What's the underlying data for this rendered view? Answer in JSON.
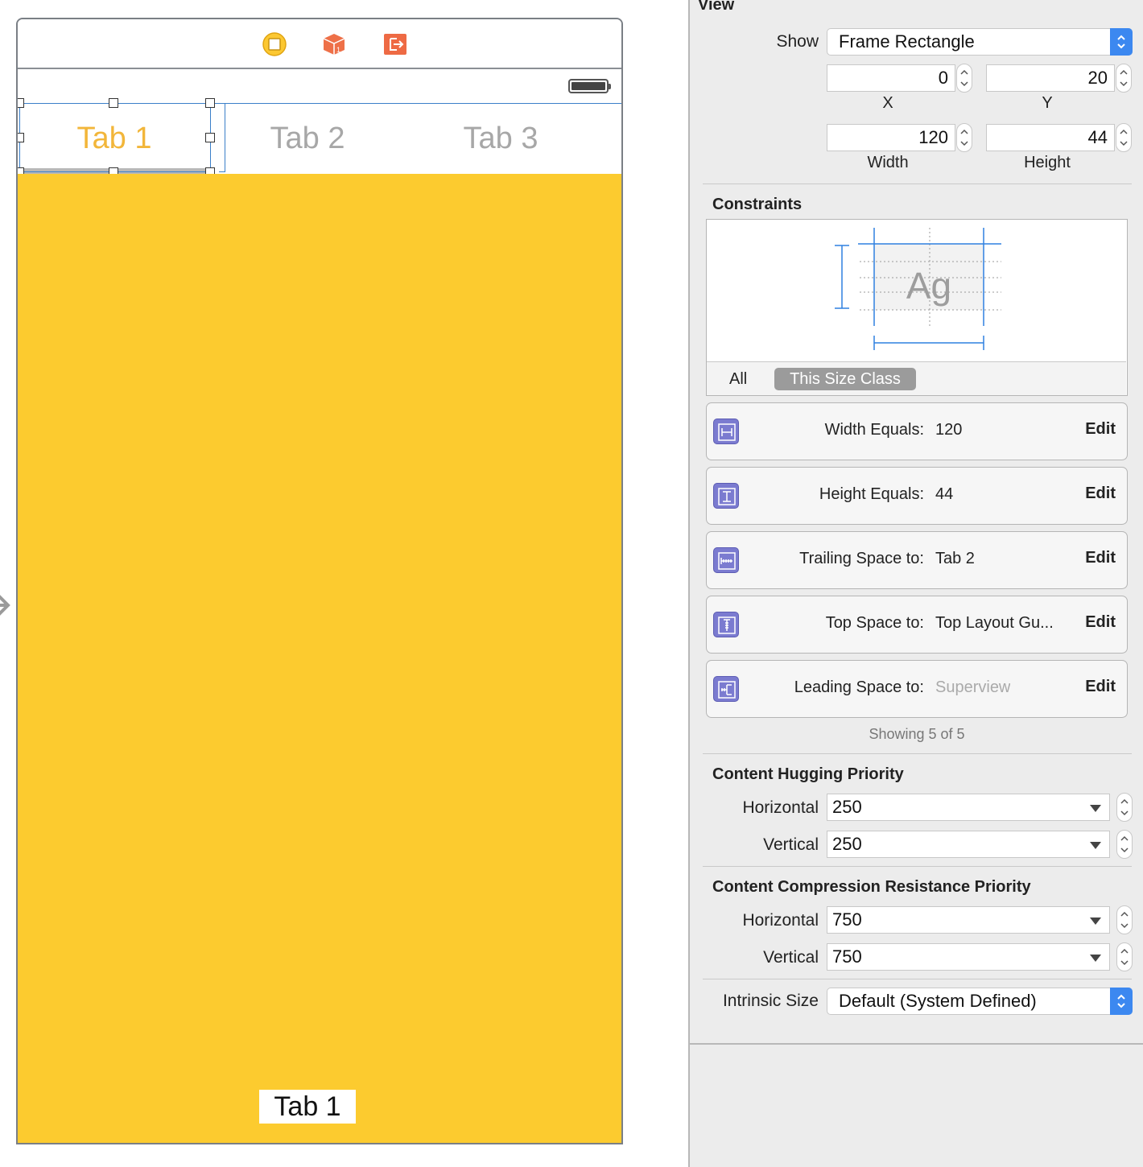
{
  "canvas": {
    "tabs": [
      {
        "label": "Tab 1",
        "selected": true
      },
      {
        "label": "Tab 2",
        "selected": false
      },
      {
        "label": "Tab 3",
        "selected": false
      }
    ],
    "content_label": "Tab 1",
    "content_color": "#fccb2f",
    "selected_tab_color": "#f2b63a",
    "dock_icons": [
      "view-controller-icon",
      "first-responder-icon",
      "exit-icon"
    ]
  },
  "inspector": {
    "section_title": "View",
    "show": {
      "label": "Show",
      "value": "Frame Rectangle"
    },
    "frame": {
      "x": {
        "label": "X",
        "value": "0"
      },
      "y": {
        "label": "Y",
        "value": "20"
      },
      "width": {
        "label": "Width",
        "value": "120"
      },
      "height": {
        "label": "Height",
        "value": "44"
      }
    },
    "constraints": {
      "title": "Constraints",
      "preview_text": "Ag",
      "segments": {
        "all": "All",
        "this_size_class": "This Size Class"
      },
      "items": [
        {
          "icon": "width-constraint-icon",
          "label": "Width Equals:",
          "value": "120",
          "muted": false,
          "edit": "Edit"
        },
        {
          "icon": "height-constraint-icon",
          "label": "Height Equals:",
          "value": "44",
          "muted": false,
          "edit": "Edit"
        },
        {
          "icon": "trailing-space-icon",
          "label": "Trailing Space to:",
          "value": "Tab 2",
          "muted": false,
          "edit": "Edit"
        },
        {
          "icon": "top-space-icon",
          "label": "Top Space to:",
          "value": "Top Layout Gu...",
          "muted": false,
          "edit": "Edit"
        },
        {
          "icon": "leading-space-icon",
          "label": "Leading Space to:",
          "value": "Superview",
          "muted": true,
          "edit": "Edit"
        }
      ],
      "showing": "Showing 5 of 5"
    },
    "hugging": {
      "title": "Content Hugging Priority",
      "horizontal": {
        "label": "Horizontal",
        "value": "250"
      },
      "vertical": {
        "label": "Vertical",
        "value": "250"
      }
    },
    "compression": {
      "title": "Content Compression Resistance Priority",
      "horizontal": {
        "label": "Horizontal",
        "value": "750"
      },
      "vertical": {
        "label": "Vertical",
        "value": "750"
      }
    },
    "intrinsic": {
      "label": "Intrinsic Size",
      "value": "Default (System Defined)"
    },
    "accent_color": "#3c88f0",
    "constraint_icon_color": "#7b7bd0"
  }
}
